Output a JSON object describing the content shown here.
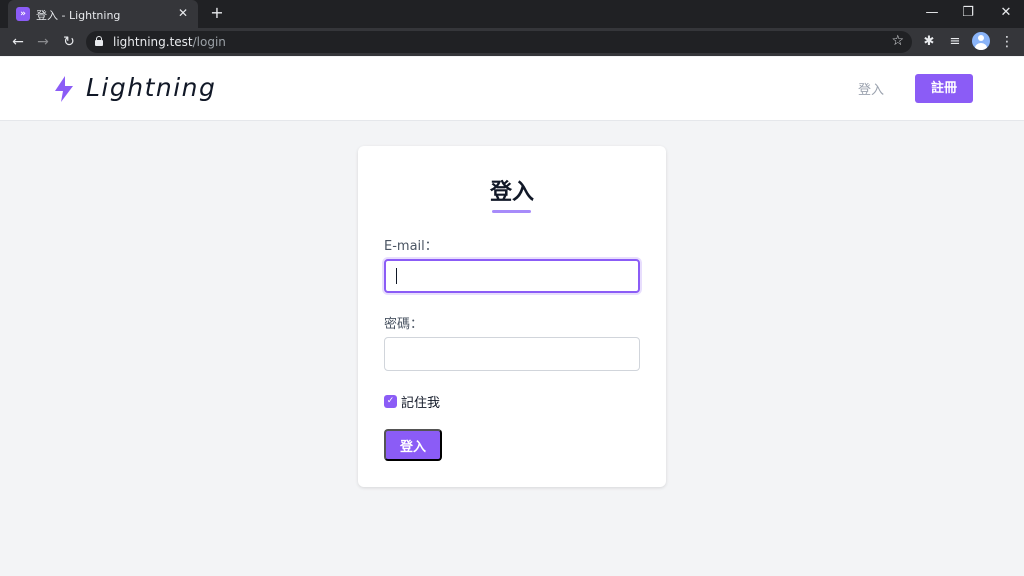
{
  "browser": {
    "tab": {
      "title": "登入 - Lightning",
      "favicon_glyph": "»",
      "close_glyph": "✕"
    },
    "new_tab_glyph": "+",
    "window_controls": {
      "minimize": "—",
      "maximize": "❐",
      "close": "✕"
    },
    "nav": {
      "back": "←",
      "forward": "→",
      "reload": "↻"
    },
    "url_host": "lightning.test",
    "url_path": "/login",
    "star_glyph": "☆",
    "extensions": {
      "puzzle": "✱",
      "media": "≡"
    },
    "menu_glyph": "⋮"
  },
  "site": {
    "brand": "Lightning",
    "nav": {
      "login": "登入",
      "register": "註冊"
    }
  },
  "login": {
    "title": "登入",
    "email_label": "E-mail：",
    "email_value": "",
    "password_label": "密碼：",
    "password_value": "",
    "remember_label": "記住我",
    "remember_checked": true,
    "remember_check_glyph": "✓",
    "submit_label": "登入"
  },
  "colors": {
    "accent": "#8b5cf6",
    "accent_light": "#a78bfa",
    "background": "#f3f4f6",
    "browser_dark": "#202124",
    "browser_toolbar": "#35363a"
  }
}
